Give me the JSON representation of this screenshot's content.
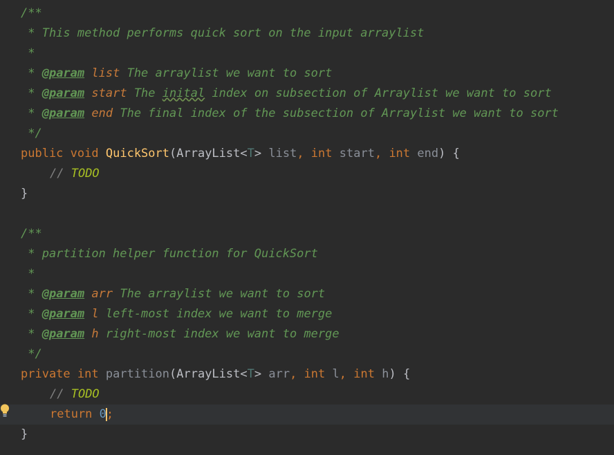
{
  "editor": {
    "language": "java",
    "doc1": {
      "open": "/**",
      "desc": " * This method performs quick sort on the input arraylist",
      "blank": " *",
      "p1": {
        "tag": "@param",
        "name": "list",
        "text": " The arraylist we want to sort"
      },
      "p2": {
        "tag": "@param",
        "name": "start",
        "text_a": " The ",
        "typo": "inital",
        "text_b": " index on subsection of Arraylist we want to sort"
      },
      "p3": {
        "tag": "@param",
        "name": "end",
        "text": " The final index of the subsection of Arraylist we want to sort"
      },
      "close": " */"
    },
    "method1": {
      "modifier": "public",
      "ret": "void",
      "name": "QuickSort",
      "ptype1": "ArrayList",
      "generic": "T",
      "pname1": "list",
      "ptype2": "int",
      "pname2": "start",
      "ptype3": "int",
      "pname3": "end",
      "todo_prefix": "// ",
      "todo": "TODO",
      "close": "}"
    },
    "doc2": {
      "open": "/**",
      "desc": " * partition helper function for QuickSort",
      "blank": " *",
      "p1": {
        "tag": "@param",
        "name": "arr",
        "text": " The arraylist we want to sort"
      },
      "p2": {
        "tag": "@param",
        "name": "l",
        "text": " left-most index we want to merge"
      },
      "p3": {
        "tag": "@param",
        "name": "h",
        "text": " right-most index we want to merge"
      },
      "close": " */"
    },
    "method2": {
      "modifier": "private",
      "ret": "int",
      "name": "partition",
      "ptype1": "ArrayList",
      "generic": "T",
      "pname1": "arr",
      "ptype2": "int",
      "pname2": "l",
      "ptype3": "int",
      "pname3": "h",
      "todo_prefix": "// ",
      "todo": "TODO",
      "return_kw": "return",
      "return_val": "0",
      "close": "}"
    },
    "colors": {
      "background": "#2b2b2b",
      "keyword": "#cc7832",
      "function": "#ffc66d",
      "comment": "#629755",
      "number": "#6897bb",
      "todo": "#a8c023"
    },
    "icons": [
      "intention-bulb-icon"
    ]
  }
}
